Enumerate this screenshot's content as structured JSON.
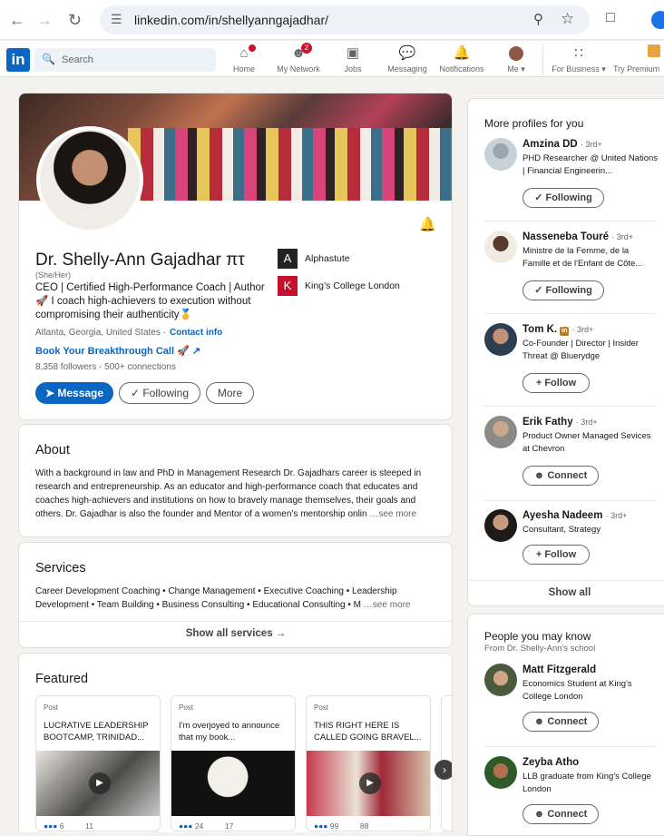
{
  "browser": {
    "url": "linkedin.com/in/shellyanngajadhar/"
  },
  "nav": {
    "search_placeholder": "Search",
    "items": [
      {
        "label": "Home",
        "icon": "home-icon",
        "badge": ""
      },
      {
        "label": "My Network",
        "icon": "network-icon",
        "badge": "2"
      },
      {
        "label": "Jobs",
        "icon": "briefcase-icon",
        "badge": ""
      },
      {
        "label": "Messaging",
        "icon": "message-icon",
        "badge": ""
      },
      {
        "label": "Notifications",
        "icon": "bell-icon",
        "badge": ""
      },
      {
        "label": "Me",
        "icon": "avatar-icon",
        "badge": ""
      }
    ],
    "business": "For Business",
    "premium": "Try Premium",
    "logo": "in"
  },
  "profile": {
    "name": "Dr. Shelly-Ann Gajadhar πτ",
    "pronouns": "(She/Her)",
    "headline": "CEO | Certified High-Performance Coach | Author 🚀 I coach high-achievers to execution without compromising their authenticity🥇",
    "location": "Atlanta, Georgia, United States ·",
    "contact": "Contact info",
    "link": "Book Your Breakthrough Call 🚀",
    "stats": "8,358 followers · 500+ connections",
    "message_btn": "Message",
    "following_btn": "Following",
    "more_btn": "More",
    "orgs": [
      {
        "name": "Alphastute",
        "logo": "A"
      },
      {
        "name": "King’s College London",
        "logo": "K"
      }
    ]
  },
  "about": {
    "title": "About",
    "text": "With a background in law and PhD in Management Research Dr. Gajadhars career is steeped in research and entrepreneurship. As an educator and high-performance coach that educates and coaches high-achievers and institutions on how to bravely manage themselves, their goals and others. Dr. Gajadhar is also the founder and Mentor of a women’s mentorship onlin",
    "see_more": "…see more"
  },
  "services": {
    "title": "Services",
    "text": "Career Development Coaching • Change Management • Executive Coaching • Leadership Development • Team Building • Business Consulting • Educational Consulting • M",
    "see_more": "…see more",
    "show_all": "Show all services →"
  },
  "featured": {
    "title": "Featured",
    "posts": [
      {
        "type": "Post",
        "text": "LUCRATIVE LEADERSHIP BOOTCAMP, TRINIDAD...",
        "reactions": "6",
        "comments": "11"
      },
      {
        "type": "Post",
        "text": "I'm overjoyed to announce that my book...",
        "reactions": "24",
        "comments": "17"
      },
      {
        "type": "Post",
        "text": "THIS RIGHT HERE IS CALLED GOING BRAVEL...",
        "reactions": "99",
        "comments": "88"
      }
    ]
  },
  "more_profiles": {
    "title": "More profiles for you",
    "people": [
      {
        "name": "Amzina DD",
        "degree": "· 3rd+",
        "desc": "PHD Researcher @ United Nations | Financial Engineerin...",
        "action": "✓ Following"
      },
      {
        "name": "Nasseneba Touré",
        "degree": "· 3rd+",
        "desc": " Ministre de la Femme, de la Famille et de l'Enfant de Côte...",
        "action": "✓ Following"
      },
      {
        "name": "Tom K.",
        "degree": "· 3rd+",
        "desc": "Co-Founder | Director | Insider Threat @ Bluerydge",
        "action": "+ Follow"
      },
      {
        "name": "Erik Fathy",
        "degree": "· 3rd+",
        "desc": "Product Owner Managed Sevices at Chevron",
        "action": "Connect"
      },
      {
        "name": "Ayesha Nadeem",
        "degree": "· 3rd+",
        "desc": "Consultant, Strategy",
        "action": "+ Follow"
      }
    ],
    "show_all": "Show all"
  },
  "people_know": {
    "title": "People you may know",
    "subtitle": "From Dr. Shelly-Ann's school",
    "people": [
      {
        "name": "Matt Fitzgerald",
        "desc": "Economics Student at King's College London",
        "action": "Connect"
      },
      {
        "name": "Zeyba Atho",
        "desc": "LLB graduate from King's College London",
        "action": "Connect"
      }
    ]
  },
  "colors": {
    "brand": "#0a66c2",
    "background": "#f4f2ee",
    "badge": "#cb112d"
  }
}
